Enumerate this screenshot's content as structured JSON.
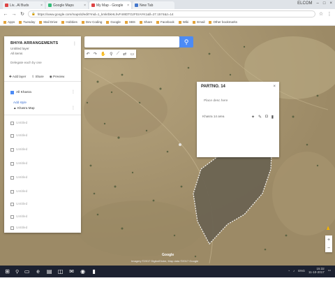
{
  "browser": {
    "tabs": [
      {
        "label": "Liv...Al Buds",
        "active": false
      },
      {
        "label": "Google Maps",
        "active": false
      },
      {
        "label": "My Map - Google",
        "active": true
      },
      {
        "label": "New Tab",
        "active": false
      }
    ],
    "window_user": "ELCOM",
    "url": "https://www.google.com/maps/d/edit?mid=1_kmkrbkHLhvF4r8DTGzF0zAYK1&ll=27.1574&z=14",
    "bookmarks": [
      "Apps",
      "Tuesday",
      "Mail Drive",
      "Hobbies",
      "Dev Coding",
      "Google",
      "SBS",
      "Share",
      "Facebook",
      "Wiki",
      "Email",
      "Other bookmarks"
    ]
  },
  "panel": {
    "title": "BHIYA ARRANGEMENTS",
    "subtitle": "Untitled layer",
    "subtitle2": "All items",
    "description": "Delegate each by one",
    "actions": [
      "Add layer",
      "Share",
      "Preview"
    ],
    "active_layer": {
      "label": "All Khasra",
      "link": "Add style",
      "item": "Khasra Map"
    },
    "layers": [
      "Untitled",
      "Untitled",
      "Untitled",
      "Untitled",
      "Untitled",
      "Untitled",
      "Untitled",
      "Untitled",
      "Untitled"
    ]
  },
  "popup": {
    "title": "PARTNO. 14",
    "body": "Place desc here",
    "footer": "Khasra 14 area",
    "tools": [
      "paint-icon",
      "edit-icon",
      "camera-icon",
      "delete-icon"
    ]
  },
  "map_controls": {
    "zoom_in": "+",
    "zoom_out": "−",
    "google_logo": "Google",
    "attribution": "Imagery ©2017 DigitalGlobe, Map data ©2017 Google"
  },
  "taskbar": {
    "clock_time": "15:32",
    "clock_date": "11-10-2017",
    "tray_lang": "ENG"
  },
  "colors": {
    "map_ground": "#ad9a74",
    "polygon_fill": "#6c6452",
    "accent": "#4c8bf5"
  }
}
